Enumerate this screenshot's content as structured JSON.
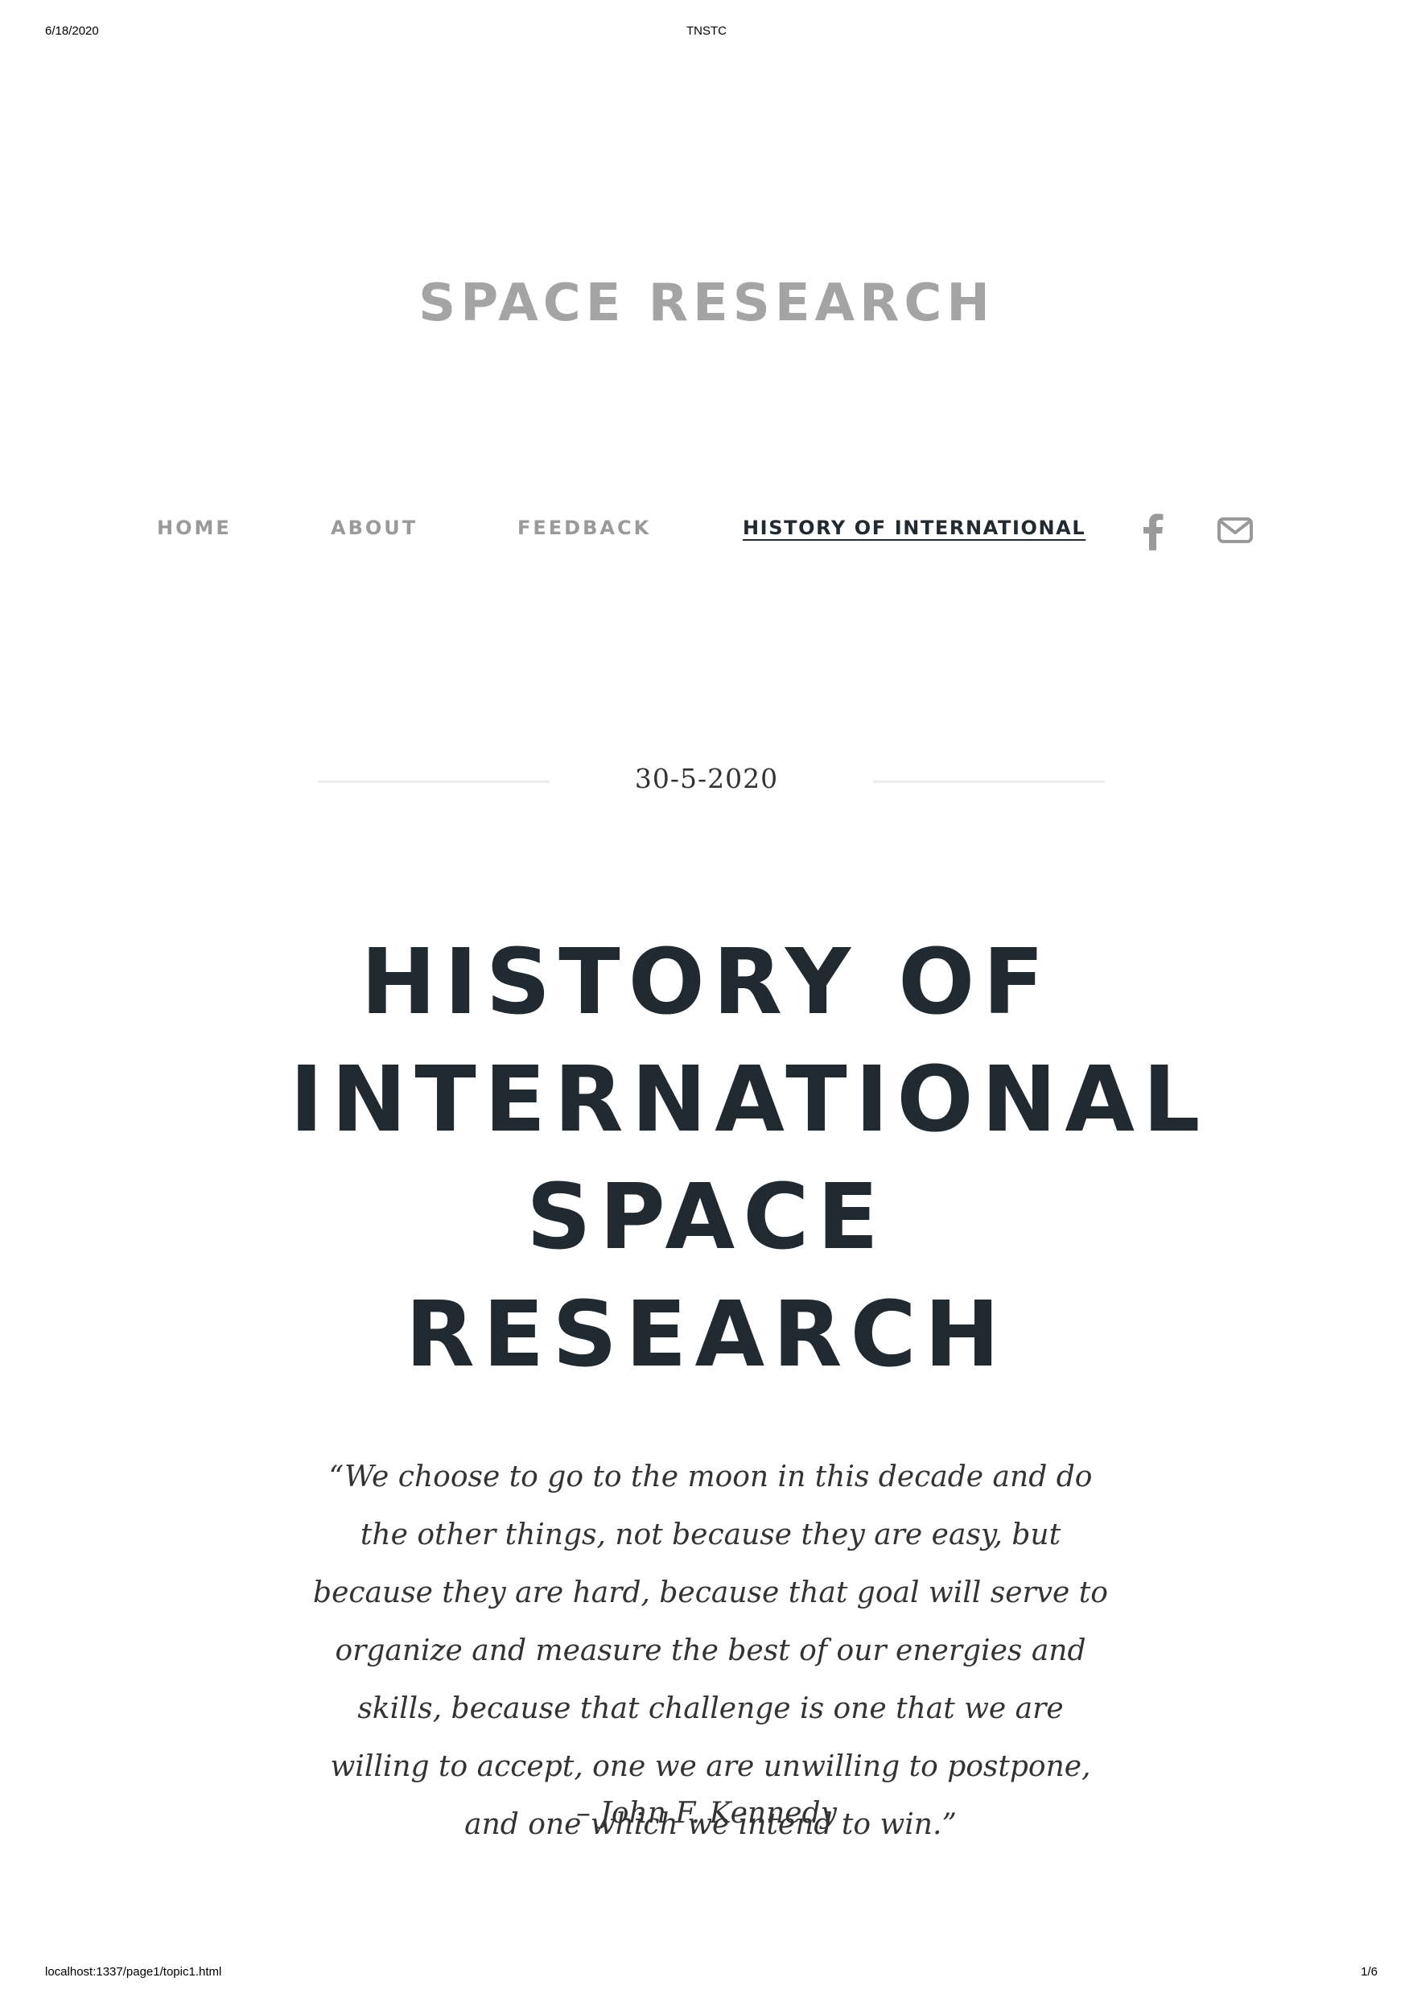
{
  "print_header": {
    "date": "6/18/2020",
    "title": "TNSTC"
  },
  "print_footer": {
    "url": "localhost:1337/page1/topic1.html",
    "page": "1/6"
  },
  "site": {
    "title": "SPACE RESEARCH"
  },
  "nav": {
    "items": [
      {
        "label": "HOME"
      },
      {
        "label": "ABOUT"
      },
      {
        "label": "FEEDBACK"
      },
      {
        "label": "HISTORY OF INTERNATIONAL"
      }
    ],
    "icons": [
      "facebook-icon",
      "mail-icon"
    ]
  },
  "post": {
    "date": "30-5-2020",
    "title": "HISTORY OF INTERNATIONAL SPACE RESEARCH",
    "quote": "“We choose to go to the moon in this decade and do the other things, not because they are easy, but because they are hard, because that goal will serve to organize and measure the best of our energies and skills, because that challenge is one that we are willing to accept, one we are unwilling to postpone, and one which we intend to win.”",
    "quote_author": "– John F. Kennedy"
  },
  "colors": {
    "heading": "#222a31",
    "muted": "#a4a4a4",
    "rule": "#ececec"
  }
}
